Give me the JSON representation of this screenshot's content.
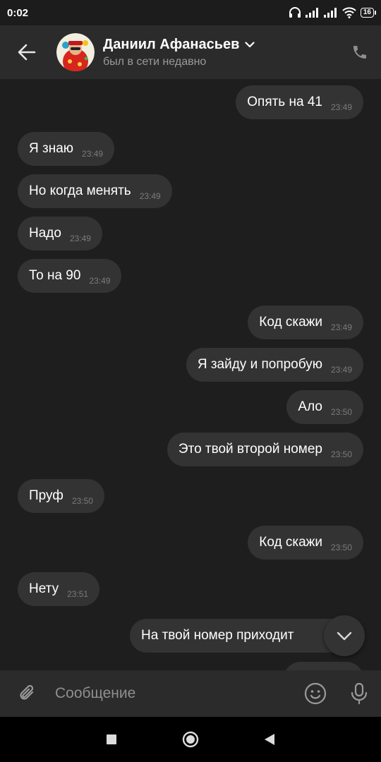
{
  "status_bar": {
    "time": "0:02",
    "battery": "16"
  },
  "header": {
    "contact_name": "Даниил Афанасьев",
    "contact_status": "был в сети недавно"
  },
  "messages": [
    {
      "text": "Опять на 41",
      "time": "23:49",
      "side": "out"
    },
    {
      "text": "Я знаю",
      "time": "23:49",
      "side": "in"
    },
    {
      "text": "Но когда менять",
      "time": "23:49",
      "side": "in"
    },
    {
      "text": "Надо",
      "time": "23:49",
      "side": "in"
    },
    {
      "text": "То на 90",
      "time": "23:49",
      "side": "in"
    },
    {
      "text": "Код скажи",
      "time": "23:49",
      "side": "out"
    },
    {
      "text": "Я зайду и попробую",
      "time": "23:49",
      "side": "out"
    },
    {
      "text": "Ало",
      "time": "23:50",
      "side": "out"
    },
    {
      "text": "Это твой второй номер",
      "time": "23:50",
      "side": "out"
    },
    {
      "text": "Пруф",
      "time": "23:50",
      "side": "in"
    },
    {
      "text": "Код скажи",
      "time": "23:50",
      "side": "out"
    },
    {
      "text": "Нету",
      "time": "23:51",
      "side": "in"
    },
    {
      "text": "На твой номер приходит",
      "time": "",
      "side": "out"
    }
  ],
  "composer": {
    "placeholder": "Сообщение"
  },
  "colors": {
    "background": "#1e1e1e",
    "header": "#2b2b2b",
    "bubble": "#333333",
    "time": "#7b7b7b"
  }
}
